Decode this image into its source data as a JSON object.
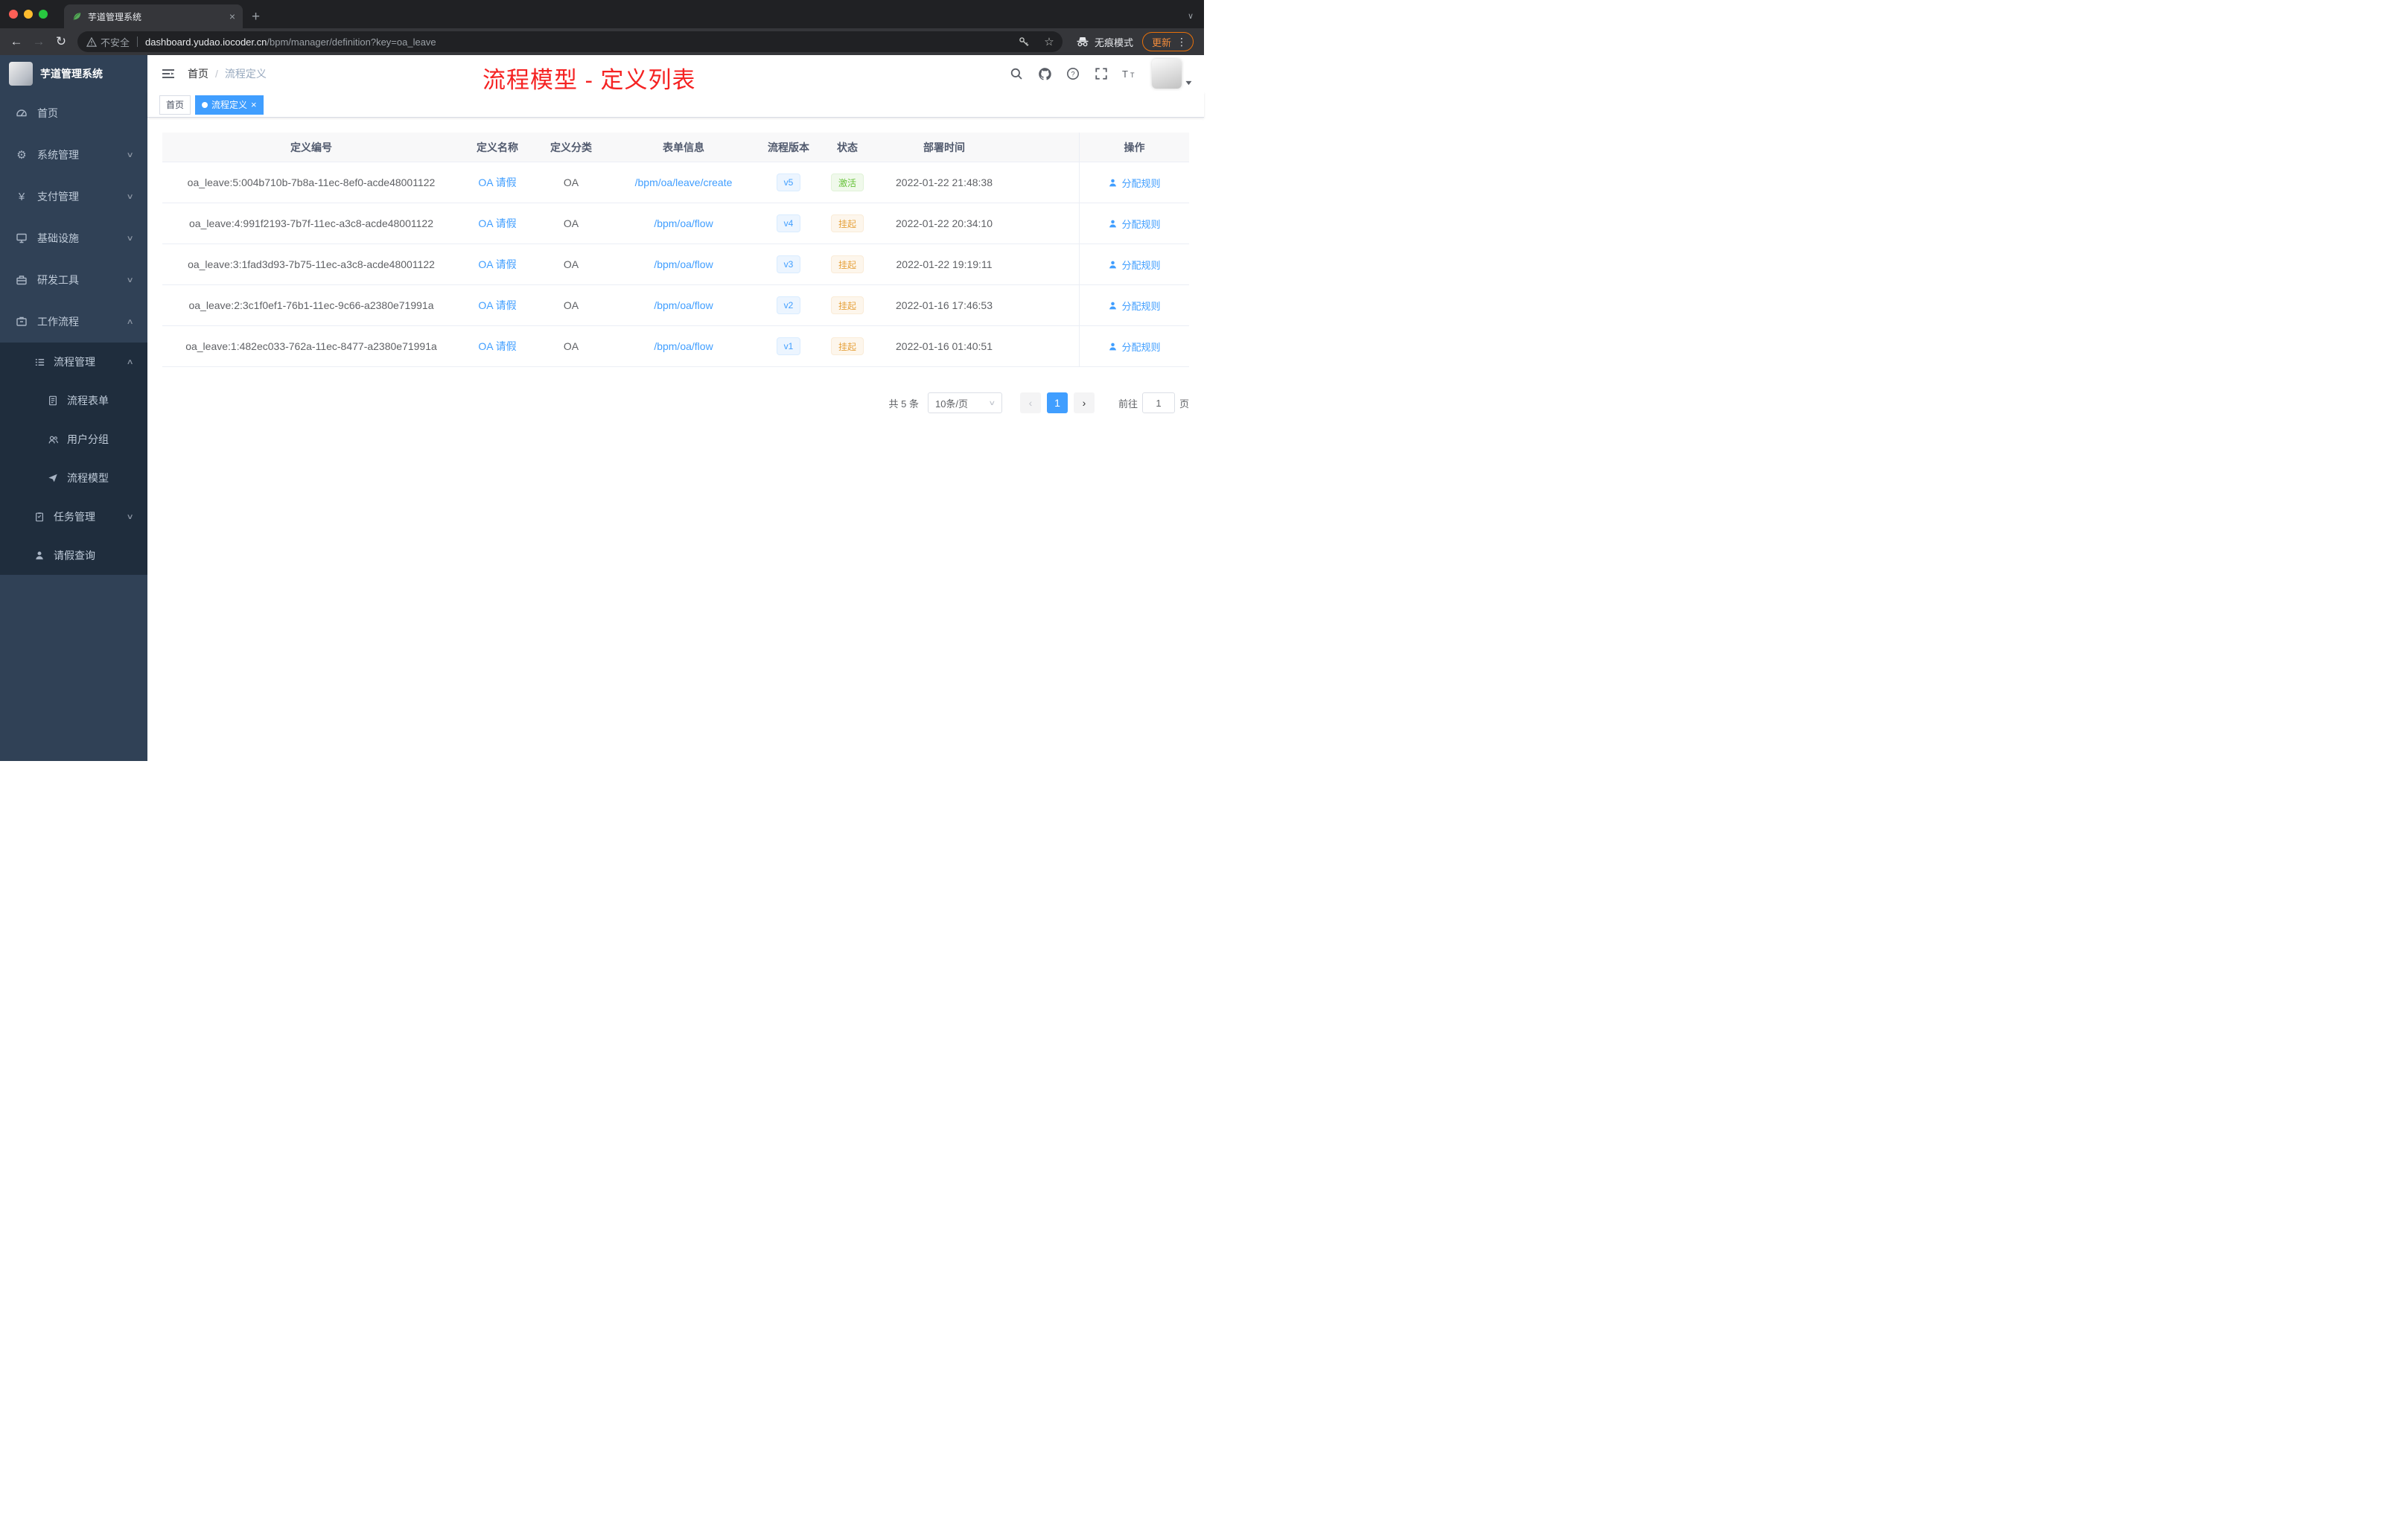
{
  "colors": {
    "accent": "#409eff",
    "success": "#67c23a",
    "warning": "#e6a23c",
    "annotation_red": "#f52222",
    "sidebar_bg": "#304156",
    "submenu_bg": "#1f2d3d",
    "tab_bar_bg": "#202124",
    "toolbar_bg": "#35363a"
  },
  "browser": {
    "tab_title": "芋道管理系统",
    "security_label": "不安全",
    "url_host": "dashboard.yudao.iocoder.cn",
    "url_path": "/bpm/manager/definition?key=oa_leave",
    "incognito_label": "无痕模式",
    "update_label": "更新"
  },
  "sidebar": {
    "logo_title": "芋道管理系统",
    "menu": [
      {
        "label": "首页",
        "icon": "dashboard-icon"
      },
      {
        "label": "系统管理",
        "icon": "gear-icon"
      },
      {
        "label": "支付管理",
        "icon": "yen-icon"
      },
      {
        "label": "基础设施",
        "icon": "infrastructure-icon"
      },
      {
        "label": "研发工具",
        "icon": "tools-icon"
      },
      {
        "label": "工作流程",
        "icon": "workflow-icon"
      }
    ],
    "submenu": {
      "process": {
        "label": "流程管理",
        "icon": "list-icon"
      },
      "process_children": [
        {
          "label": "流程表单",
          "icon": "form-icon"
        },
        {
          "label": "用户分组",
          "icon": "user-group-icon"
        },
        {
          "label": "流程模型",
          "icon": "paper-plane-icon"
        }
      ],
      "task": {
        "label": "任务管理",
        "icon": "task-icon"
      },
      "leave": {
        "label": "请假查询",
        "icon": "person-icon"
      }
    }
  },
  "navbar": {
    "breadcrumb": {
      "home": "首页",
      "separator": "/",
      "current": "流程定义"
    }
  },
  "annotation": "流程模型 - 定义列表",
  "tags": {
    "home": "首页",
    "current": "流程定义"
  },
  "table": {
    "columns": {
      "id": "定义编号",
      "name": "定义名称",
      "category": "定义分类",
      "form": "表单信息",
      "version": "流程版本",
      "status": "状态",
      "deployed_at": "部署时间",
      "actions": "操作"
    },
    "rows": [
      {
        "id": "oa_leave:5:004b710b-7b8a-11ec-8ef0-acde48001122",
        "name": "OA 请假",
        "category": "OA",
        "form": "/bpm/oa/leave/create",
        "version": "v5",
        "status": "激活",
        "status_type": "success",
        "deployed_at": "2022-01-22 21:48:38",
        "action": "分配规则"
      },
      {
        "id": "oa_leave:4:991f2193-7b7f-11ec-a3c8-acde48001122",
        "name": "OA 请假",
        "category": "OA",
        "form": "/bpm/oa/flow",
        "version": "v4",
        "status": "挂起",
        "status_type": "warning",
        "deployed_at": "2022-01-22 20:34:10",
        "action": "分配规则"
      },
      {
        "id": "oa_leave:3:1fad3d93-7b75-11ec-a3c8-acde48001122",
        "name": "OA 请假",
        "category": "OA",
        "form": "/bpm/oa/flow",
        "version": "v3",
        "status": "挂起",
        "status_type": "warning",
        "deployed_at": "2022-01-22 19:19:11",
        "action": "分配规则"
      },
      {
        "id": "oa_leave:2:3c1f0ef1-76b1-11ec-9c66-a2380e71991a",
        "name": "OA 请假",
        "category": "OA",
        "form": "/bpm/oa/flow",
        "version": "v2",
        "status": "挂起",
        "status_type": "warning",
        "deployed_at": "2022-01-16 17:46:53",
        "action": "分配规则"
      },
      {
        "id": "oa_leave:1:482ec033-762a-11ec-8477-a2380e71991a",
        "name": "OA 请假",
        "category": "OA",
        "form": "/bpm/oa/flow",
        "version": "v1",
        "status": "挂起",
        "status_type": "warning",
        "deployed_at": "2022-01-16 01:40:51",
        "action": "分配规则"
      }
    ]
  },
  "pagination": {
    "total": "共 5 条",
    "page_size": "10条/页",
    "page": "1",
    "goto_label": "前往",
    "goto_value": "1",
    "unit_label": "页"
  }
}
